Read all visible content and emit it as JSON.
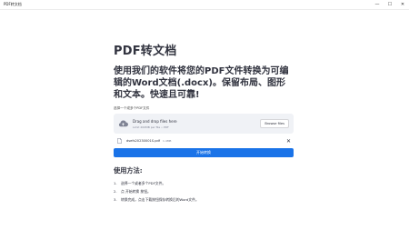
{
  "window": {
    "title": "PDF转文档",
    "controls": {
      "minimize": "—",
      "maximize": "☐",
      "close": "✕"
    }
  },
  "main": {
    "title": "PDF转文档",
    "subtitle": "使用我们的软件将您的PDF文件转换为可编辑的Word文档(.docx)。保留布局、图形和文本。快速且可靠!",
    "uploader": {
      "label": "选择一个或多个PDF文件",
      "drop_text": "Drag and drop files here",
      "limit_text": "Limit 200MB per file • PDF",
      "browse_label": "Browse files",
      "file": {
        "name": "dsefs20230001S.pdf",
        "size": "1.4MB"
      }
    },
    "convert_button": "开始转换",
    "howto_title": "使用方法:",
    "steps": [
      {
        "num": "1.",
        "text": "选择一个或者多个PDF文件。"
      },
      {
        "num": "2.",
        "text": "点 开始转换 按钮。"
      },
      {
        "num": "3.",
        "text": "转换完成，点击下载按钮保存转换后的Word文件。"
      }
    ]
  },
  "colors": {
    "primary": "#1a73e8",
    "dropzone_bg": "#f0f2f6"
  }
}
